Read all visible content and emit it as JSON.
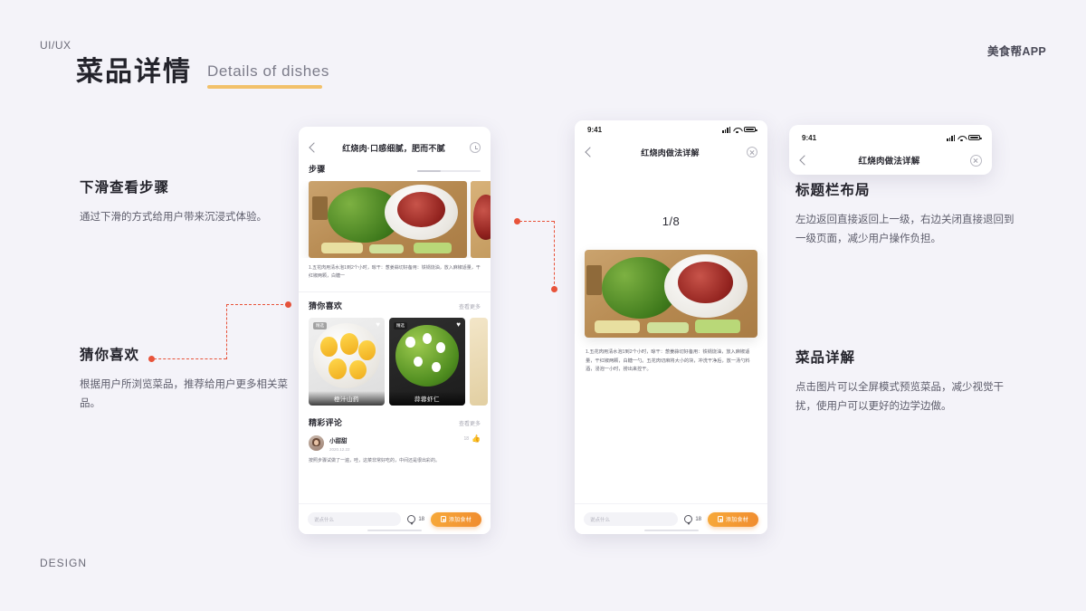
{
  "header": {
    "kicker": "UI/UX",
    "title_cn": "菜品详情",
    "title_en": "Details of dishes",
    "brand": "美食帮APP",
    "footer_tag": "DESIGN"
  },
  "annotations": {
    "left_top": {
      "heading": "下滑查看步骤",
      "body": "通过下滑的方式给用户带来沉浸式体验。"
    },
    "left_bottom": {
      "heading": "猜你喜欢",
      "body": "根据用户所浏览菜品，推荐给用户更多相关菜品。"
    },
    "right_top": {
      "heading": "标题栏布局",
      "body": "左边返回直接返回上一级，右边关闭直接退回到一级页面，减少用户操作负担。"
    },
    "right_bottom": {
      "heading": "菜品详解",
      "body": "点击图片可以全屏模式预览菜品，减少视觉干扰，使用户可以更好的边学边做。"
    }
  },
  "colors": {
    "background": "#f4f3f9",
    "accent_underline": "#f2c16a",
    "connector": "#e8533a",
    "cta": "#f08c2e"
  },
  "phone1": {
    "nav_title": "红烧肉·口感细腻，肥而不腻",
    "nav_back_icon": "chevron-left-icon",
    "nav_right_icon": "timer-icon",
    "steps_section": {
      "title": "步骤",
      "step_text": "1.五花肉用清水泡1到2个小时，晾干：葱姜蒜切好备用：铁锅烧油，放入麻椒适量，干红椒两颗，白糖一"
    },
    "recommend_section": {
      "title": "猜你喜欢",
      "more": "查看更多",
      "cards": [
        {
          "label": "橙汁山药",
          "badge": "精选"
        },
        {
          "label": "蒜蓉虾仁",
          "badge": "精选"
        }
      ]
    },
    "comments_section": {
      "title": "精彩评论",
      "more": "查看更多",
      "comment": {
        "name": "小甜甜",
        "date": "2020.12.22",
        "likes": "18",
        "body": "按照步骤试做了一遍，哇，这菜非常好吃的，中间还是很出彩的。"
      }
    },
    "bottom_bar": {
      "input_placeholder": "说点什么",
      "comment_count": "18",
      "cta_label": "添加食材"
    }
  },
  "phone2": {
    "status_time": "9:41",
    "nav_title": "红烧肉做法详解",
    "nav_back_icon": "chevron-left-icon",
    "nav_close_icon": "close-circle-icon",
    "pager": "1/8",
    "detail_text": "1.五花肉用清水泡1到2个小时，晾干：葱姜蒜切好备用：铁锅烧油，放入麻椒适量，干红椒两颗，白糖一勺。五花肉切麻将大小的块，冲洗干净后，放一汤勺料酒，浸泡一小时，捞出来控干。",
    "bottom_bar": {
      "input_placeholder": "说点什么",
      "comment_count": "18",
      "cta_label": "添加食材"
    }
  },
  "phone3": {
    "status_time": "9:41",
    "nav_title": "红烧肉做法详解",
    "nav_back_icon": "chevron-left-icon",
    "nav_close_icon": "close-circle-icon"
  }
}
